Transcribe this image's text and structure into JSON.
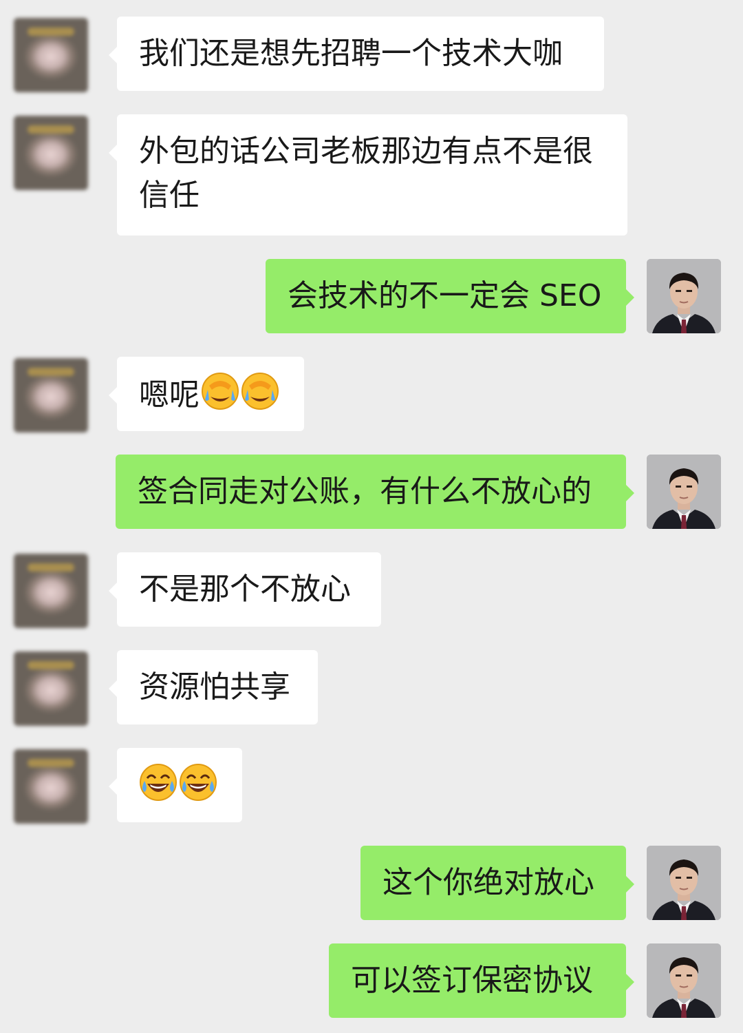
{
  "messages": [
    {
      "side": "in",
      "text": "我们还是想先招聘一个技术大咖"
    },
    {
      "side": "in",
      "text": "外包的话公司老板那边有点不是很信任"
    },
    {
      "side": "out",
      "text": "会技术的不一定会 SEO"
    },
    {
      "side": "in",
      "text": "嗯呢",
      "emoji": [
        "facepalm-crying",
        "facepalm-crying"
      ]
    },
    {
      "side": "out",
      "text": "签合同走对公账，有什么不放心的"
    },
    {
      "side": "in",
      "text": "不是那个不放心"
    },
    {
      "side": "in",
      "text": "资源怕共享"
    },
    {
      "side": "in",
      "text": "",
      "emoji": [
        "tears-of-joy",
        "tears-of-joy"
      ]
    },
    {
      "side": "out",
      "text": "这个你绝对放心"
    },
    {
      "side": "out",
      "text": "可以签订保密协议"
    }
  ],
  "colors": {
    "background": "#ededed",
    "incoming_bubble": "#ffffff",
    "outgoing_bubble": "#95ec69",
    "text": "#191919"
  },
  "icons": {
    "incoming_avatar": "blurred-contact-avatar",
    "outgoing_avatar": "man-in-suit-avatar"
  }
}
